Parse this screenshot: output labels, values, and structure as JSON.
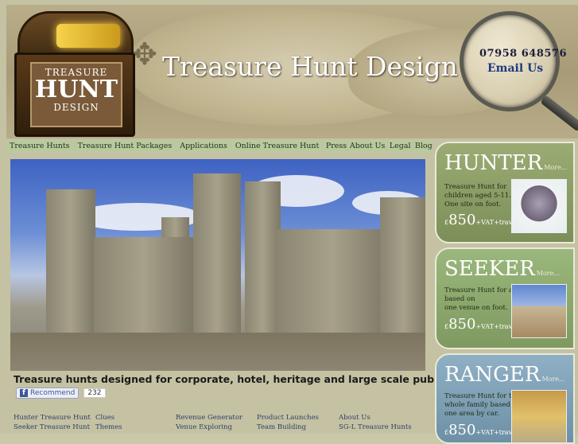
{
  "header": {
    "title": "Treasure Hunt Design",
    "phone": "07958 648576",
    "email_label": "Email Us",
    "logo_lines": [
      "TREASURE",
      "HUNT",
      "DESIGN"
    ]
  },
  "nav": {
    "items": [
      {
        "label": "Treasure Hunts"
      },
      {
        "label": "Treasure Hunt Packages"
      },
      {
        "label": "Applications"
      },
      {
        "label": "Online Treasure Hunt"
      },
      {
        "label": "Press"
      },
      {
        "label": "About Us"
      },
      {
        "label": "Legal"
      },
      {
        "label": "Blog"
      }
    ]
  },
  "main": {
    "tagline": "Treasure hunts designed for corporate, hotel, heritage and large scale public hunts.",
    "facebook": {
      "label": "Recommend",
      "count": "232"
    }
  },
  "panels": [
    {
      "title": "HUNTER",
      "more": "More...",
      "desc": [
        "Treasure Hunt for",
        "children aged 5-11.",
        "One site on foot."
      ],
      "price": "850",
      "price_suffix": "+VAT+travel",
      "currency": "£",
      "color": "#8d9e6a"
    },
    {
      "title": "SEEKER",
      "more": "More...",
      "desc": [
        "Treasure Hunt for adults",
        "based on",
        "one venue on foot."
      ],
      "price": "850",
      "price_suffix": "+VAT+travel",
      "currency": "£",
      "color": "#8aa66d"
    },
    {
      "title": "RANGER",
      "more": "More...",
      "desc": [
        "Treasure Hunt for the",
        "whole family based in",
        "one area by car."
      ],
      "price": "850",
      "price_suffix": "+VAT+travel",
      "currency": "£",
      "color": "#7a9cb0"
    }
  ],
  "footer": {
    "columns": [
      [
        "Hunter Treasure Hunt",
        "Seeker Treasure Hunt"
      ],
      [
        "Clues",
        "Themes"
      ],
      [
        "Revenue Generator",
        "Venue Exploring"
      ],
      [
        "Product Launches",
        "Team Building"
      ],
      [
        "About Us",
        "SG-L Treasure Hunts"
      ]
    ]
  }
}
